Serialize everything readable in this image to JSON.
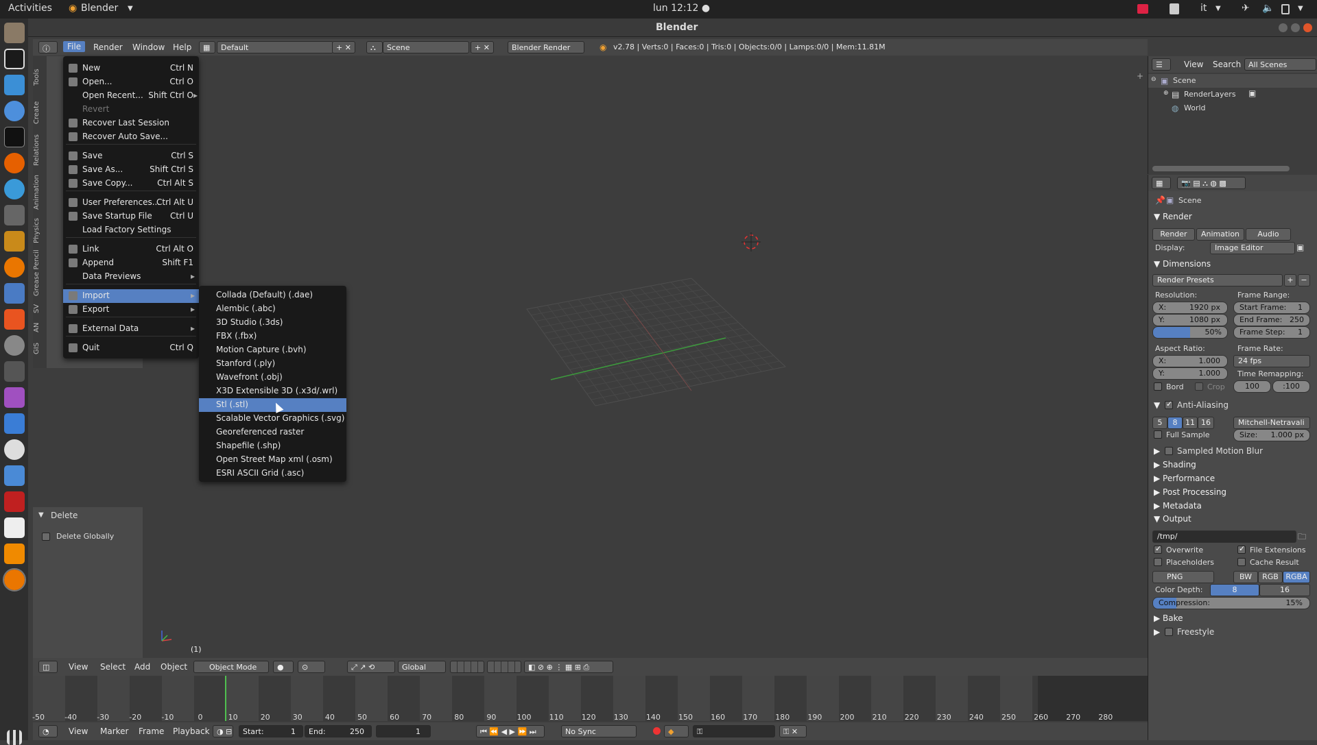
{
  "topbar": {
    "activities": "Activities",
    "app": "Blender",
    "clock": "lun 12:12 ●",
    "lang": "it"
  },
  "window": {
    "title": "Blender"
  },
  "header": {
    "menus": [
      "File",
      "Render",
      "Window",
      "Help"
    ],
    "layout": "Default",
    "scene": "Scene",
    "engine": "Blender Render",
    "stats": "v2.78 | Verts:0 | Faces:0 | Tris:0 | Objects:0/0 | Lamps:0/0 | Mem:11.81M"
  },
  "left_tabs": [
    "Tools",
    "Create",
    "Relations",
    "Animation",
    "Physics",
    "Grease Pencil",
    "SV",
    "AN",
    "GIS"
  ],
  "operator": {
    "title": "Delete",
    "option": "Delete Globally"
  },
  "file_menu": {
    "items": [
      {
        "label": "New",
        "shortcut": "Ctrl N"
      },
      {
        "label": "Open...",
        "shortcut": "Ctrl O"
      },
      {
        "label": "Open Recent...",
        "shortcut": "Shift Ctrl O"
      },
      {
        "label": "Revert",
        "shortcut": ""
      },
      {
        "label": "Recover Last Session",
        "shortcut": ""
      },
      {
        "label": "Recover Auto Save...",
        "shortcut": ""
      },
      {
        "label": "Save",
        "shortcut": "Ctrl S"
      },
      {
        "label": "Save As...",
        "shortcut": "Shift Ctrl S"
      },
      {
        "label": "Save Copy...",
        "shortcut": "Ctrl Alt S"
      },
      {
        "label": "User Preferences...",
        "shortcut": "Ctrl Alt U"
      },
      {
        "label": "Save Startup File",
        "shortcut": "Ctrl U"
      },
      {
        "label": "Load Factory Settings",
        "shortcut": ""
      },
      {
        "label": "Link",
        "shortcut": "Ctrl Alt O"
      },
      {
        "label": "Append",
        "shortcut": "Shift F1"
      },
      {
        "label": "Data Previews",
        "shortcut": ""
      },
      {
        "label": "Import",
        "shortcut": ""
      },
      {
        "label": "Export",
        "shortcut": ""
      },
      {
        "label": "External Data",
        "shortcut": ""
      },
      {
        "label": "Quit",
        "shortcut": "Ctrl Q"
      }
    ]
  },
  "import_menu": {
    "items": [
      "Collada (Default) (.dae)",
      "Alembic (.abc)",
      "3D Studio (.3ds)",
      "FBX (.fbx)",
      "Motion Capture (.bvh)",
      "Stanford (.ply)",
      "Wavefront (.obj)",
      "X3D Extensible 3D (.x3d/.wrl)",
      "Stl (.stl)",
      "Scalable Vector Graphics (.svg)",
      "Georeferenced raster",
      "Shapefile (.shp)",
      "Open Street Map xml (.osm)",
      "ESRI ASCII Grid (.asc)"
    ],
    "highlighted": "Stl (.stl)"
  },
  "viewport": {
    "frame_label": "(1)"
  },
  "view3d_header": {
    "menus": [
      "View",
      "Select",
      "Add",
      "Object"
    ],
    "mode": "Object Mode",
    "orientation": "Global"
  },
  "timeline": {
    "ticks": [
      "-50",
      "-40",
      "-30",
      "-20",
      "-10",
      "0",
      "10",
      "20",
      "30",
      "40",
      "50",
      "60",
      "70",
      "80",
      "90",
      "100",
      "110",
      "120",
      "130",
      "140",
      "150",
      "160",
      "170",
      "180",
      "190",
      "200",
      "210",
      "220",
      "230",
      "240",
      "250",
      "260",
      "270",
      "280"
    ]
  },
  "timeline_header": {
    "menus": [
      "View",
      "Marker",
      "Frame",
      "Playback"
    ],
    "start": "Start:",
    "start_val": "1",
    "end": "End:",
    "end_val": "250",
    "current": "1",
    "sync": "No Sync"
  },
  "outliner": {
    "menus": [
      "View",
      "Search"
    ],
    "filter": "All Scenes",
    "items": [
      "Scene",
      "RenderLayers",
      "World"
    ]
  },
  "properties": {
    "context": "Scene",
    "render_title": "Render",
    "render_buttons": [
      "Render",
      "Animation",
      "Audio"
    ],
    "display_label": "Display:",
    "display": "Image Editor",
    "dimensions": "Dimensions",
    "presets": "Render Presets",
    "resolution": "Resolution:",
    "res_x": "X:",
    "res_x_val": "1920 px",
    "res_y": "Y:",
    "res_y_val": "1080 px",
    "res_pct": "50%",
    "frame_range": "Frame Range:",
    "start_frame": "Start Frame:",
    "start_frame_val": "1",
    "end_frame": "End Frame:",
    "end_frame_val": "250",
    "frame_step": "Frame Step:",
    "frame_step_val": "1",
    "aspect": "Aspect Ratio:",
    "asp_x": "X:",
    "asp_x_val": "1.000",
    "asp_y": "Y:",
    "asp_y_val": "1.000",
    "frame_rate": "Frame Rate:",
    "fps": "24 fps",
    "time_remap": "Time Remapping:",
    "remap_old": "100",
    "remap_new": ":100",
    "border": "Bord",
    "crop": "Crop",
    "aa": "Anti-Aliasing",
    "aa_samples": [
      "5",
      "8",
      "11",
      "16"
    ],
    "aa_filter": "Mitchell-Netravali",
    "full_sample": "Full Sample",
    "size": "Size:",
    "size_val": "1.000 px",
    "motion_blur": "Sampled Motion Blur",
    "shading": "Shading",
    "performance": "Performance",
    "post": "Post Processing",
    "metadata": "Metadata",
    "output": "Output",
    "path": "/tmp/",
    "overwrite": "Overwrite",
    "file_ext": "File Extensions",
    "placeholders": "Placeholders",
    "cache": "Cache Result",
    "format": "PNG",
    "color_modes": [
      "BW",
      "RGB",
      "RGBA"
    ],
    "depth_label": "Color Depth:",
    "depth_vals": [
      "8",
      "16"
    ],
    "compression": "Compression:",
    "compression_val": "15%",
    "bake": "Bake",
    "freestyle": "Freestyle"
  }
}
